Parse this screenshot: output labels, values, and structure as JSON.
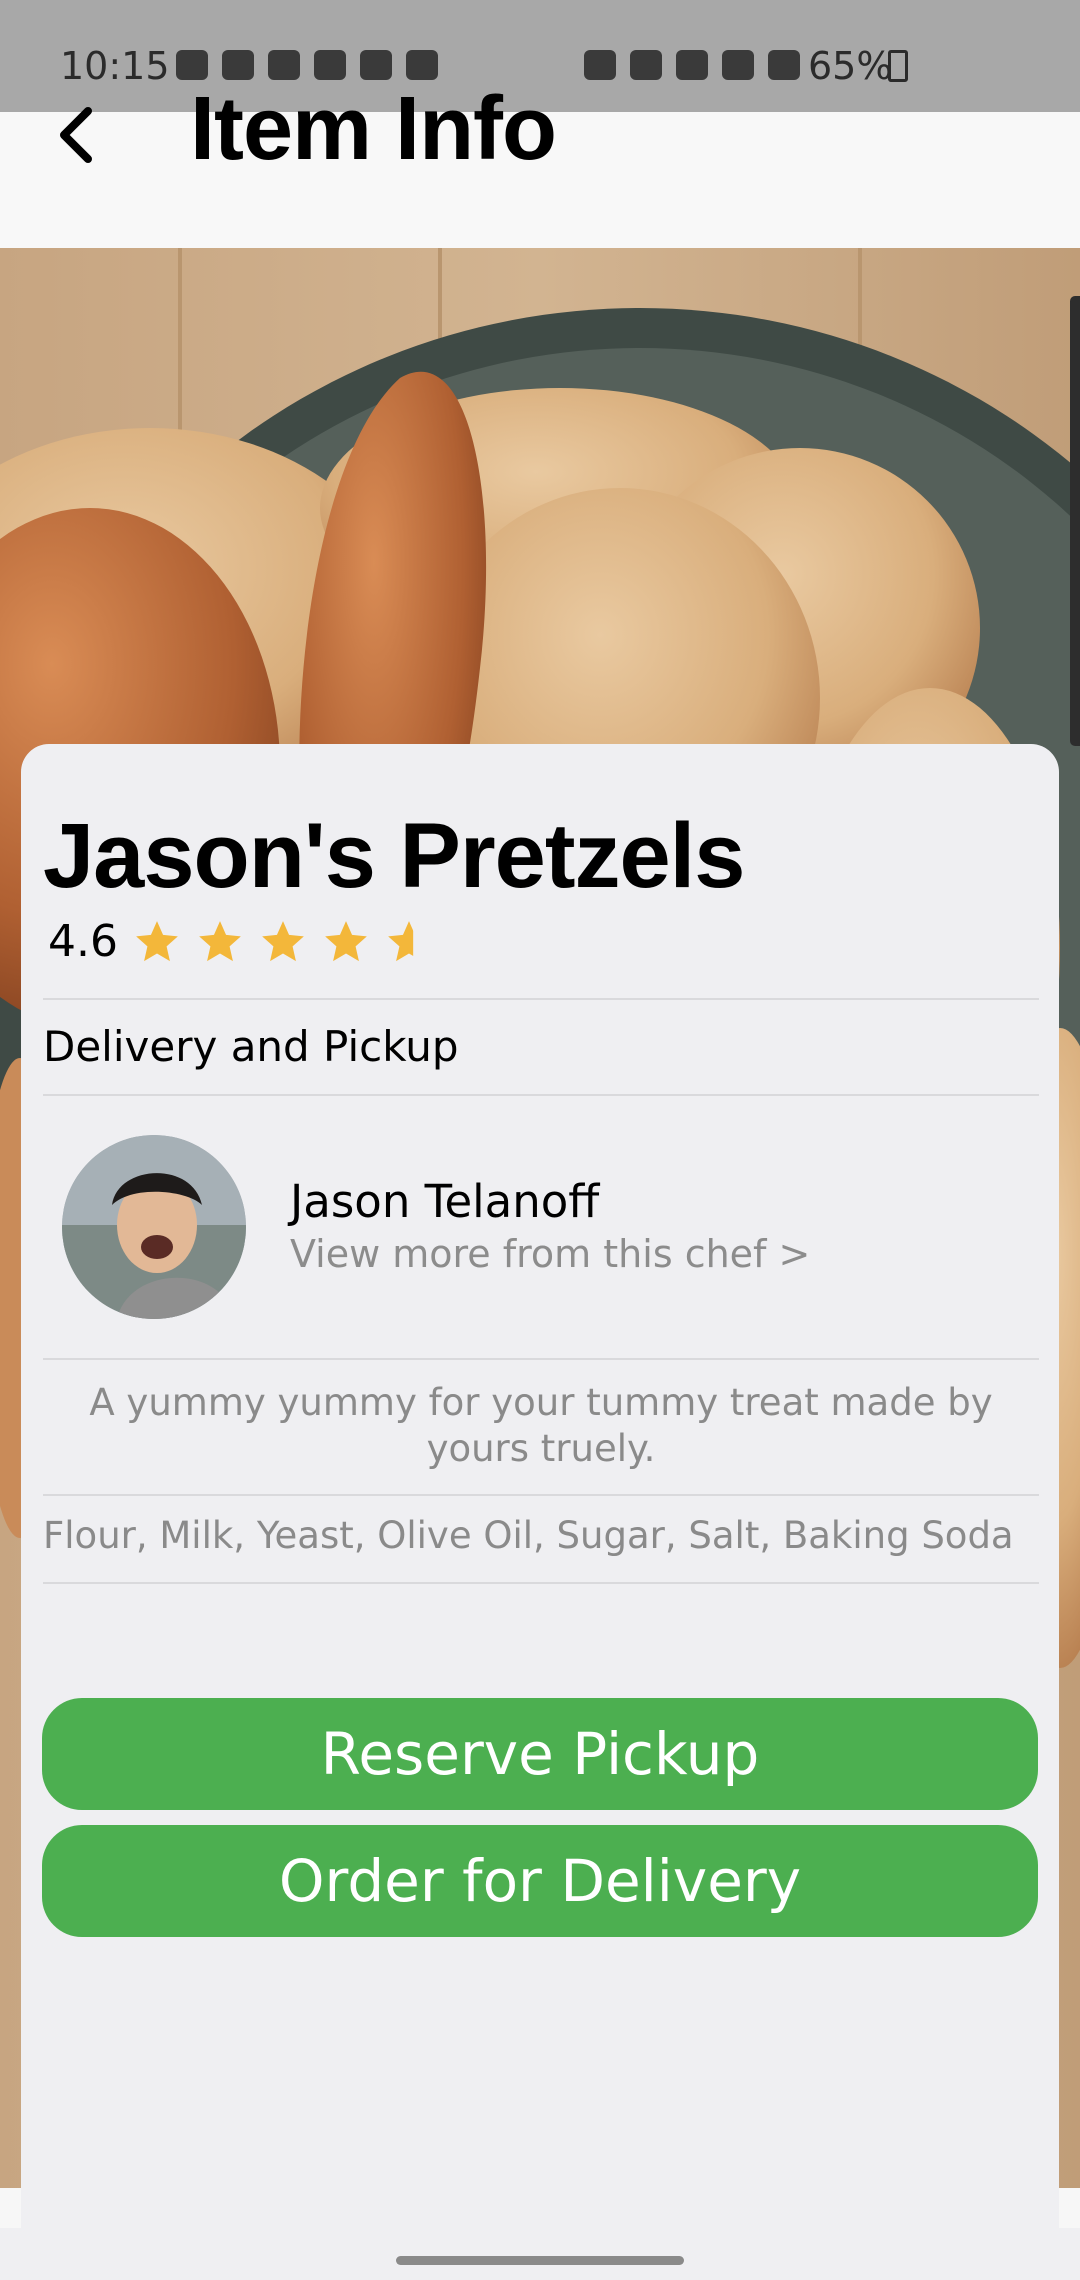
{
  "status_bar": {
    "time": "10:15",
    "battery": "65%",
    "left_icons": [
      "notification-icon",
      "gallery-icon",
      "gmail-icon",
      "linkedin-icon",
      "app-icon",
      "game-icon"
    ],
    "right_icons": [
      "alarm-icon",
      "mute-icon",
      "wifi-icon",
      "volte-icon",
      "signal-icon"
    ]
  },
  "header": {
    "title": "Item Info",
    "back_icon": "chevron-left-icon"
  },
  "item": {
    "name": "Jason's Pretzels",
    "rating": "4.6",
    "rating_out_of": 5,
    "delivery_label": "Delivery and Pickup",
    "description": "A yummy yummy for your tummy treat made by yours truely.",
    "ingredients": "Flour, Milk, Yeast, Olive Oil, Sugar, Salt, Baking Soda"
  },
  "chef": {
    "name": "Jason Telanoff",
    "link_label": "View more from this chef >"
  },
  "actions": {
    "reserve_label": "Reserve Pickup",
    "delivery_label": "Order for Delivery"
  },
  "colors": {
    "accent": "#4caf50",
    "star": "#f3b73a",
    "card_bg": "#efeff2",
    "muted_text": "#8a8a8a"
  }
}
